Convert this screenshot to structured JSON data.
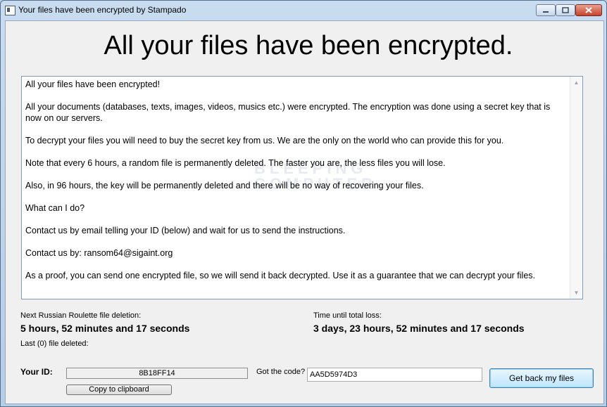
{
  "window": {
    "title": "Your files have been encrypted by Stampado",
    "minimize_icon": "minimize-icon",
    "maximize_icon": "maximize-icon",
    "close_icon": "close-icon"
  },
  "heading": "All your files have been encrypted.",
  "message": {
    "paragraphs": [
      "All your files have been encrypted!",
      "All your documents (databases, texts, images, videos, musics etc.) were encrypted. The encryption was done using a secret key that is now on our servers.",
      "To decrypt your files you will need to buy the secret key from us. We are the only on the world who can provide this for you.",
      "Note that every 6 hours, a random file is permanently deleted. The faster you are, the less files you will lose.",
      "Also, in 96 hours, the key will be permanently deleted and there will be no way of recovering your files.",
      "What can I do?",
      "Contact us by email telling your ID (below) and wait for us to send the instructions.",
      "Contact us by: ransom64@sigaint.org",
      "As a proof, you can send one encrypted file, so we will send it back decrypted. Use it as a guarantee that we can decrypt your files."
    ],
    "watermark_line1": "BLEEPING",
    "watermark_line2": "COMPUTER"
  },
  "roulette": {
    "label": "Next Russian Roulette file deletion:",
    "value": "5 hours, 52 minutes and 17 seconds",
    "last_deleted": "Last (0) file deleted:"
  },
  "total_loss": {
    "label": "Time until total loss:",
    "value": "3 days, 23 hours, 52 minutes and 17 seconds"
  },
  "id_section": {
    "label": "Your ID:",
    "value": "8B18FF14",
    "copy_button": "Copy to clipboard"
  },
  "code_section": {
    "label": "Got the code?",
    "value": "AA5D5974D3",
    "submit_button": "Get back my files"
  }
}
